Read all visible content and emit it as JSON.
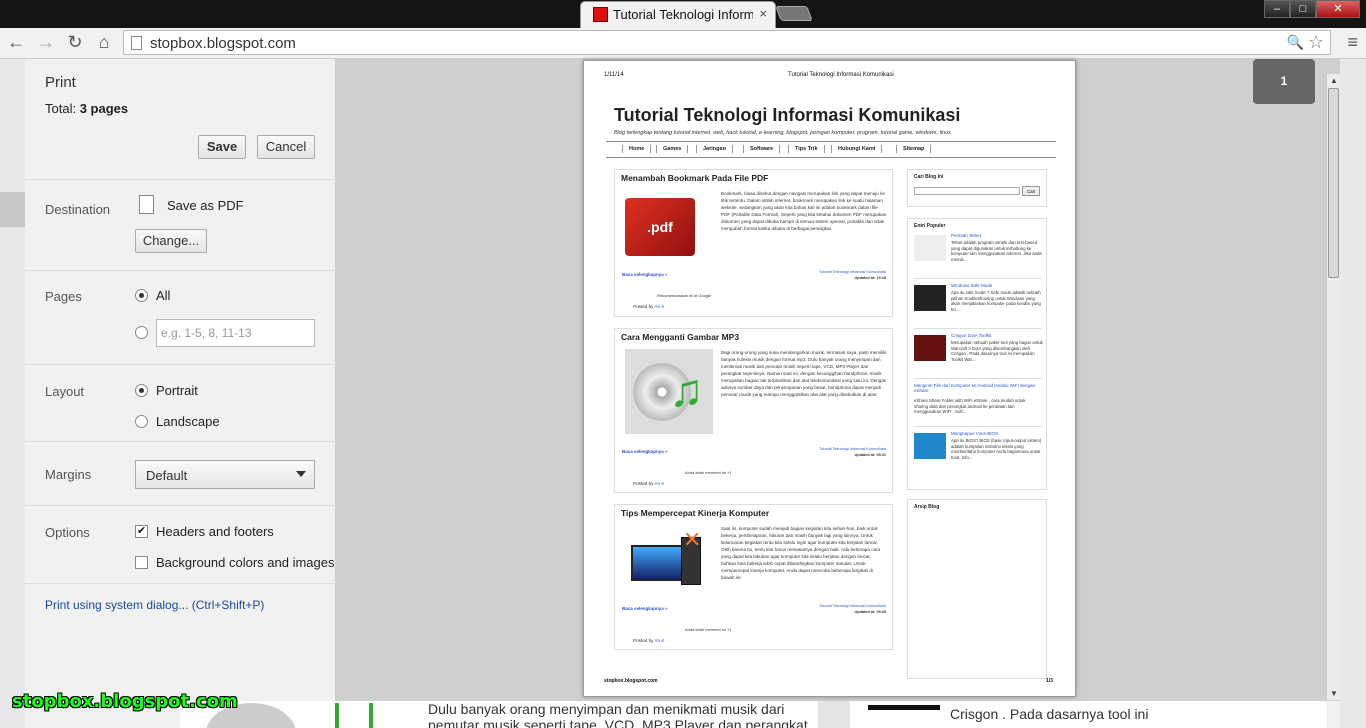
{
  "browser": {
    "tab_title": "Tutorial Teknologi Inform",
    "tab_close": "×",
    "url": "stopbox.blogspot.com",
    "win_min": "–",
    "win_max": "□",
    "win_close": "✕"
  },
  "print": {
    "title": "Print",
    "total_label": "Total:",
    "total_value": "3 pages",
    "save_label": "Save",
    "cancel_label": "Cancel",
    "destination_label": "Destination",
    "destination_value": "Save as PDF",
    "change_label": "Change...",
    "pages_label": "Pages",
    "pages_all": "All",
    "pages_placeholder": "e.g. 1-5, 8, 11-13",
    "layout_label": "Layout",
    "layout_portrait": "Portrait",
    "layout_landscape": "Landscape",
    "margins_label": "Margins",
    "margins_value": "Default",
    "options_label": "Options",
    "opt_headers": "Headers and footers",
    "opt_background": "Background colors and images",
    "system_dialog": "Print using system dialog... (Ctrl+Shift+P)"
  },
  "preview": {
    "page_badge": "1",
    "header_date": "1/11/14",
    "header_title": "Tutorial Teknologi Informasi Komunikasi",
    "blog_title": "Tutorial Teknologi Informasi Komunikasi",
    "blog_subtitle": "Blog terlengkap tentang tutorial internet, web, hack tutorial, e-learning, blogspot, jaringan komputer, program, tutorial game, windows, linux",
    "nav": [
      "Home",
      "Games",
      "Jaringan",
      "Software",
      "Tips Trik",
      "Hubungi Kami",
      "Sitemap"
    ],
    "posts": [
      {
        "title": "Menambah Bookmark Pada File PDF",
        "text": "Bookmark, biasa disebut dengan navigasi merupakan link yang dapat menuju ke titik tertentu. Dalam istilah internet, bookmark merupakan link ke suatu halaman website, sedangkan yang akan kita bahas kali ini adalah bookmark dalam file PDF (Portable Data Format). Seperti yang kita ketahui dokumen PDF merupakan dokumen yang dapat dibuka hampir di semua sistem operasi, portable dan tidak mengubah format ketika dibuka di berbagai perangkat.",
        "more": "Baca selengkapnya »",
        "source": "Tutorial Teknologi Informasi Komunikasi",
        "updated": "Updated at: 19.28",
        "like": "Rekomendasikan ini di Google",
        "by": "Posted by",
        "author": "Ari K"
      },
      {
        "title": "Cara Mengganti Gambar MP3",
        "text": "Bagi orang-orang yang suka mendengarkan musik, termasuk saya, pasti memiliki banyak koleksi musik dengan format mp3. Dulu banyak orang menyimpan dan menikmati musik dari pemutar musik seperti tape, VCD, MP3 Player dan perangkat sejenisnya. Namun saat ini, dengan kecanggihan handphone, musik merupakan bagian tak terpisahkan dari alat telekomunikasi yang satu ini. Dengan adanya sumber daya dan penyimpanan yang besar, handphone dapat menjadi pemutar musik yang mampu menggantikan alat-alat yang disebutkan di atas.",
        "more": "Baca selengkapnya »",
        "source": "Tutorial Teknologi Informasi Komunikasi",
        "updated": "Updated at: 05.31",
        "like": "Anda telah memberi ini +1",
        "by": "Posted by",
        "author": "Ari K"
      },
      {
        "title": "Tips Mempercepat Kinerja Komputer",
        "text": "Saat ini, komputer sudah menjadi bagian kegiatan kita sehari-hari, baik untuk bekerja, pembelajaran, hiburan dan masih banyak lagi yang lainnya. Untuk kelancaran kegiatan tentu kita selalu ingin agar komputer kita berjalan lancar. Oleh karena itu, tentu kita harus merawatnya dengan baik. Ada beberapa cara yang dapat kita lakukan agar komputer kita selalu berjalan dengan lancar, bahkan bisa bekerja lebih cepat dibandingkan komputer standar. Untuk mempercepat kinerja komputer, Anda dapat mencoba beberapa langkah di bawah ini:",
        "more": "Baca selengkapnya »",
        "source": "Tutorial Teknologi Informasi Komunikasi",
        "updated": "Updated at: 09.05",
        "like": "Anda telah memberi ini +1",
        "by": "Posted by",
        "author": "Ari K"
      }
    ],
    "sidebar": {
      "search_title": "Cari Blog Ini",
      "search_btn": "Cari",
      "popular_title": "Entri Populer",
      "popular": [
        {
          "title": "Perintah Telnet",
          "desc": "Telnet adalah program simple dan text-based yang dapat digunakan untuk terhubung ke komputer lain menggunakan Internet. Jika anda memili..."
        },
        {
          "title": "Windows Safe Mode",
          "desc": "Apa itu safe mode ? Safe mode adalah sebuah pilihan troubleshooting untuk Windows yang akan menjalankan komputer pada kondisi yang ter..."
        },
        {
          "title": "Crisgon DotA Toolkit",
          "desc": "Merupakan sebuah paket tool yang bagus untuk Warcraft 3 DotA yang dikembangkan oleh Crisgon . Pada dasarnya tool ini merupakan Toolkit War..."
        },
        {
          "title": "Mengirim File dari Komputer ke Android melalui WiFi dengan eShare",
          "desc": "eShare Share Folder with WiFi eShare , cara mudah untuk sharing data dari perangkat android ke peralatan lain menggunakan WIFI . Soft..."
        },
        {
          "title": "Menghapus Virus BIOS",
          "desc": "Apa itu BIOS? BIOS (basic input-output sistem) adalah kumpulan instruksi teknis yang memberitahu komputer Anda bagaimana untuk boot. Info..."
        }
      ],
      "archive_title": "Arsip Blog"
    },
    "footer_url": "stopbox.blogspot.com",
    "footer_page": "1/3"
  },
  "background": {
    "text_left": "Dulu banyak orang menyimpan dan menikmati musik dari pemutar musik seperti tape, VCD, MP3 Player dan perangkat",
    "text_right": "Crisgon . Pada dasarnya tool ini"
  },
  "watermark": "stopbox.blogspot.com"
}
